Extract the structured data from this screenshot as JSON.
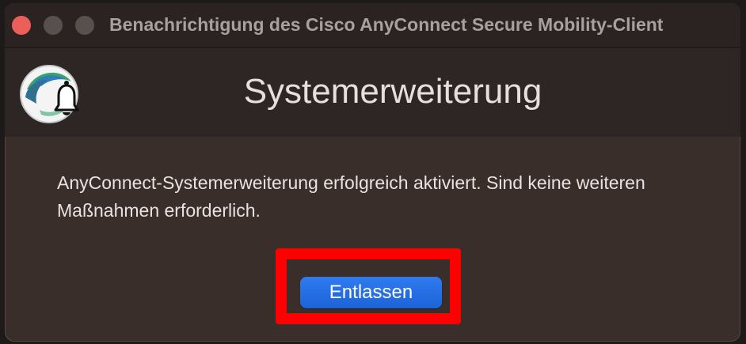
{
  "window": {
    "title": "Benachrichtigung des Cisco AnyConnect Secure Mobility-Client"
  },
  "header": {
    "title": "Systemerweiterung",
    "icon": "anyconnect-bell-icon"
  },
  "message": {
    "text": "AnyConnect-Systemerweiterung erfolgreich aktiviert. Sind keine weiteren Maßnahmen erforderlich."
  },
  "actions": {
    "dismiss_label": "Entlassen"
  },
  "colors": {
    "accent_button": "#1c63d8",
    "highlight": "#ff0000",
    "window_bg": "#3a2e2b",
    "close_button": "#ec5f58"
  }
}
